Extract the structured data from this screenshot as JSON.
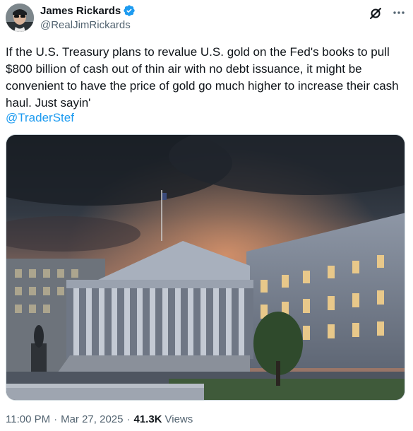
{
  "author": {
    "display_name": "James Rickards",
    "handle": "@RealJimRickards",
    "verified": true,
    "verified_color": "#1d9bf0"
  },
  "header_actions": {
    "grok_icon": "grok-icon",
    "more_icon": "more-icon"
  },
  "tweet": {
    "text": "If the U.S. Treasury plans to revalue U.S. gold on the Fed's books to pull $800 billion of cash out of thin air with no debt issuance, it might be convenient to have the price of gold go much higher to increase their cash haul. Just sayin'",
    "mention": "@TraderStef",
    "accent_color": "#1d9bf0"
  },
  "media": {
    "image_subject": "treasury-building-photo"
  },
  "meta": {
    "time": "11:00 PM",
    "separator": "·",
    "date": "Mar 27, 2025",
    "views_count": "41.3K",
    "views_label": "Views"
  }
}
